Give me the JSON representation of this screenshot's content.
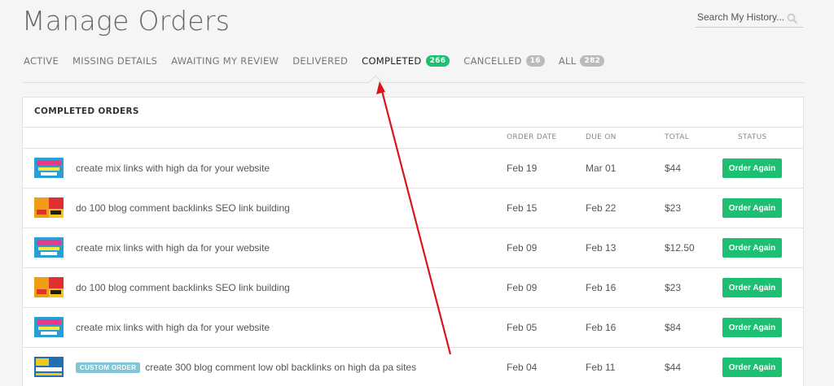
{
  "page": {
    "title": "Manage Orders"
  },
  "search": {
    "placeholder": "Search My History..."
  },
  "tabs": [
    {
      "label": "ACTIVE"
    },
    {
      "label": "MISSING DETAILS"
    },
    {
      "label": "AWAITING MY REVIEW"
    },
    {
      "label": "DELIVERED"
    },
    {
      "label": "COMPLETED",
      "count": "266",
      "active": true
    },
    {
      "label": "CANCELLED",
      "count": "16"
    },
    {
      "label": "ALL",
      "count": "282"
    }
  ],
  "panel": {
    "title": "COMPLETED ORDERS",
    "columns": {
      "order_date": "ORDER DATE",
      "due_on": "DUE ON",
      "total": "TOTAL",
      "status": "STATUS"
    }
  },
  "orders": [
    {
      "thumb": "mix-links-thumbnail",
      "title": "create mix links with high da for your website",
      "order_date": "Feb 19",
      "due_on": "Mar 01",
      "total": "$44",
      "action": "Order Again"
    },
    {
      "thumb": "blog-comment-thumbnail",
      "title": "do 100 blog comment backlinks SEO link building",
      "order_date": "Feb 15",
      "due_on": "Feb 22",
      "total": "$23",
      "action": "Order Again"
    },
    {
      "thumb": "mix-links-thumbnail",
      "title": "create mix links with high da for your website",
      "order_date": "Feb 09",
      "due_on": "Feb 13",
      "total": "$12.50",
      "action": "Order Again"
    },
    {
      "thumb": "blog-comment-thumbnail",
      "title": "do 100 blog comment backlinks SEO link building",
      "order_date": "Feb 09",
      "due_on": "Feb 16",
      "total": "$23",
      "action": "Order Again"
    },
    {
      "thumb": "mix-links-thumbnail",
      "title": "create mix links with high da for your website",
      "order_date": "Feb 05",
      "due_on": "Feb 16",
      "total": "$84",
      "action": "Order Again"
    },
    {
      "thumb": "300-backlinks-thumbnail",
      "tag": "CUSTOM ORDER",
      "title": "create 300 blog comment low obl backlinks on high da pa sites",
      "order_date": "Feb 04",
      "due_on": "Feb 11",
      "total": "$44",
      "action": "Order Again"
    }
  ],
  "colors": {
    "accent": "#1dbf73",
    "annotation_arrow": "#d9141b",
    "custom_tag": "#7fc6d9"
  }
}
